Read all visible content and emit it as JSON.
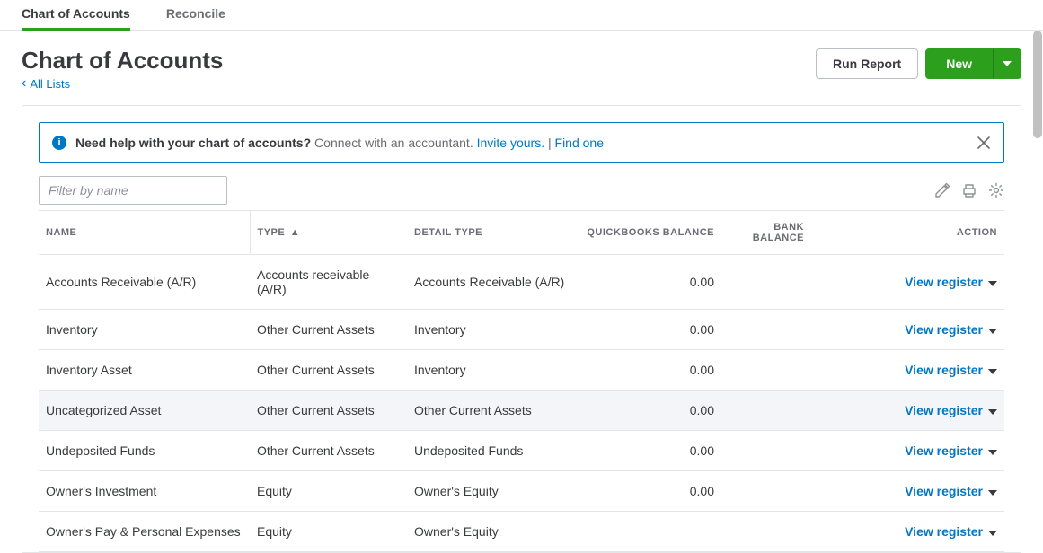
{
  "tabs": [
    {
      "label": "Chart of Accounts",
      "active": true
    },
    {
      "label": "Reconcile",
      "active": false
    }
  ],
  "page": {
    "title": "Chart of Accounts",
    "back_label": "All Lists"
  },
  "actions": {
    "run_report": "Run Report",
    "new_label": "New"
  },
  "banner": {
    "bold": "Need help with your chart of accounts?",
    "tail": "Connect with an accountant.",
    "invite": "Invite yours.",
    "sep": "|",
    "find": "Find one"
  },
  "filter": {
    "placeholder": "Filter by name"
  },
  "columns": {
    "name": "NAME",
    "type": "TYPE",
    "detail": "DETAIL TYPE",
    "qb_bal": "QUICKBOOKS BALANCE",
    "bank_bal": "BANK BALANCE",
    "action": "ACTION"
  },
  "action_label": "View register",
  "rows": [
    {
      "name": "Accounts Receivable (A/R)",
      "type": "Accounts receivable (A/R)",
      "detail": "Accounts Receivable (A/R)",
      "qb": "0.00",
      "bank": "",
      "highlight": false
    },
    {
      "name": "Inventory",
      "type": "Other Current Assets",
      "detail": "Inventory",
      "qb": "0.00",
      "bank": "",
      "highlight": false
    },
    {
      "name": "Inventory Asset",
      "type": "Other Current Assets",
      "detail": "Inventory",
      "qb": "0.00",
      "bank": "",
      "highlight": false
    },
    {
      "name": "Uncategorized Asset",
      "type": "Other Current Assets",
      "detail": "Other Current Assets",
      "qb": "0.00",
      "bank": "",
      "highlight": true
    },
    {
      "name": "Undeposited Funds",
      "type": "Other Current Assets",
      "detail": "Undeposited Funds",
      "qb": "0.00",
      "bank": "",
      "highlight": false
    },
    {
      "name": "Owner's Investment",
      "type": "Equity",
      "detail": "Owner's Equity",
      "qb": "0.00",
      "bank": "",
      "highlight": false
    },
    {
      "name": "Owner's Pay & Personal Expenses",
      "type": "Equity",
      "detail": "Owner's Equity",
      "qb": "",
      "bank": "",
      "highlight": false
    }
  ]
}
